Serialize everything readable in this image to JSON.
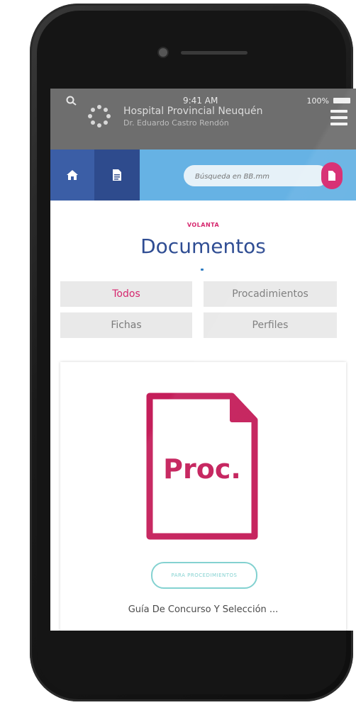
{
  "status_bar": {
    "time": "9:41 AM",
    "battery": "100%"
  },
  "header": {
    "hospital_name": "Hospital Provincial Neuquén",
    "hospital_subtitle": "Dr. Eduardo Castro Rendón"
  },
  "navbar": {
    "search_placeholder": "Búsqueda en BB.mm"
  },
  "main": {
    "section_label": "VOLANTA",
    "title": "Documentos",
    "filters": [
      {
        "label": "Todos",
        "active": true
      },
      {
        "label": "Procadimientos",
        "active": false
      },
      {
        "label": "Fichas",
        "active": false
      },
      {
        "label": "Perfiles",
        "active": false
      }
    ]
  },
  "document_card": {
    "icon_label": "Proc.",
    "tag": "PARA PROCEDIMIENTOS",
    "title": "Guía De Concurso Y Selección ..."
  },
  "colors": {
    "accent_pink": "#d6276e",
    "title_blue": "#2f4d93",
    "navbar_blue": "#66b2e4",
    "nav_dark_blue": "#2e4b8d",
    "tag_teal": "#7fd0cf"
  }
}
